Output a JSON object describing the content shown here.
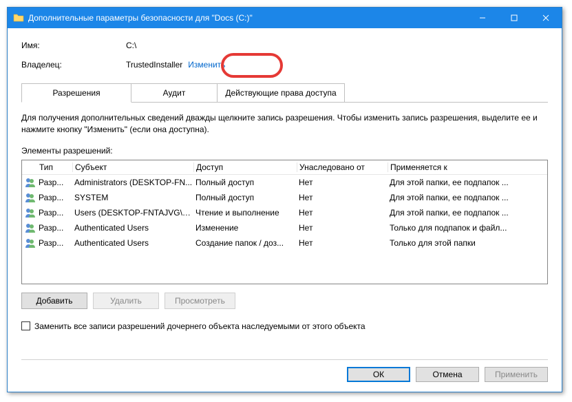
{
  "window": {
    "title": "Дополнительные параметры безопасности  для \"Docs (С:)\""
  },
  "header": {
    "name_label": "Имя:",
    "name_value": "C:\\",
    "owner_label": "Владелец:",
    "owner_value": "TrustedInstaller",
    "change_link": "Изменить"
  },
  "tabs": {
    "permissions": "Разрешения",
    "auditing": "Аудит",
    "effective": "Действующие права доступа"
  },
  "info": {
    "line": "Для получения дополнительных сведений дважды щелкните запись разрешения. Чтобы изменить запись разрешения, выделите ее и нажмите кнопку \"Изменить\" (если она доступна).",
    "entries_label": "Элементы разрешений:"
  },
  "columns": {
    "type": "Тип",
    "subject": "Субъект",
    "access": "Доступ",
    "inherited": "Унаследовано от",
    "applies": "Применяется к"
  },
  "rows": [
    {
      "type": "Разр...",
      "subject": "Administrators (DESKTOP-FN...",
      "access": "Полный доступ",
      "inherited": "Нет",
      "applies": "Для этой папки, ее подпапок ..."
    },
    {
      "type": "Разр...",
      "subject": "SYSTEM",
      "access": "Полный доступ",
      "inherited": "Нет",
      "applies": "Для этой папки, ее подпапок ..."
    },
    {
      "type": "Разр...",
      "subject": "Users (DESKTOP-FNTAJVG\\Us...",
      "access": "Чтение и выполнение",
      "inherited": "Нет",
      "applies": "Для этой папки, ее подпапок ..."
    },
    {
      "type": "Разр...",
      "subject": "Authenticated Users",
      "access": "Изменение",
      "inherited": "Нет",
      "applies": "Только для подпапок и файл..."
    },
    {
      "type": "Разр...",
      "subject": "Authenticated Users",
      "access": "Создание папок / доз...",
      "inherited": "Нет",
      "applies": "Только для этой папки"
    }
  ],
  "buttons": {
    "add": "Добавить",
    "remove": "Удалить",
    "view": "Просмотреть"
  },
  "checkbox": {
    "label": "Заменить все записи разрешений дочернего объекта наследуемыми от этого объекта"
  },
  "dialog_buttons": {
    "ok": "ОК",
    "cancel": "Отмена",
    "apply": "Применить"
  }
}
